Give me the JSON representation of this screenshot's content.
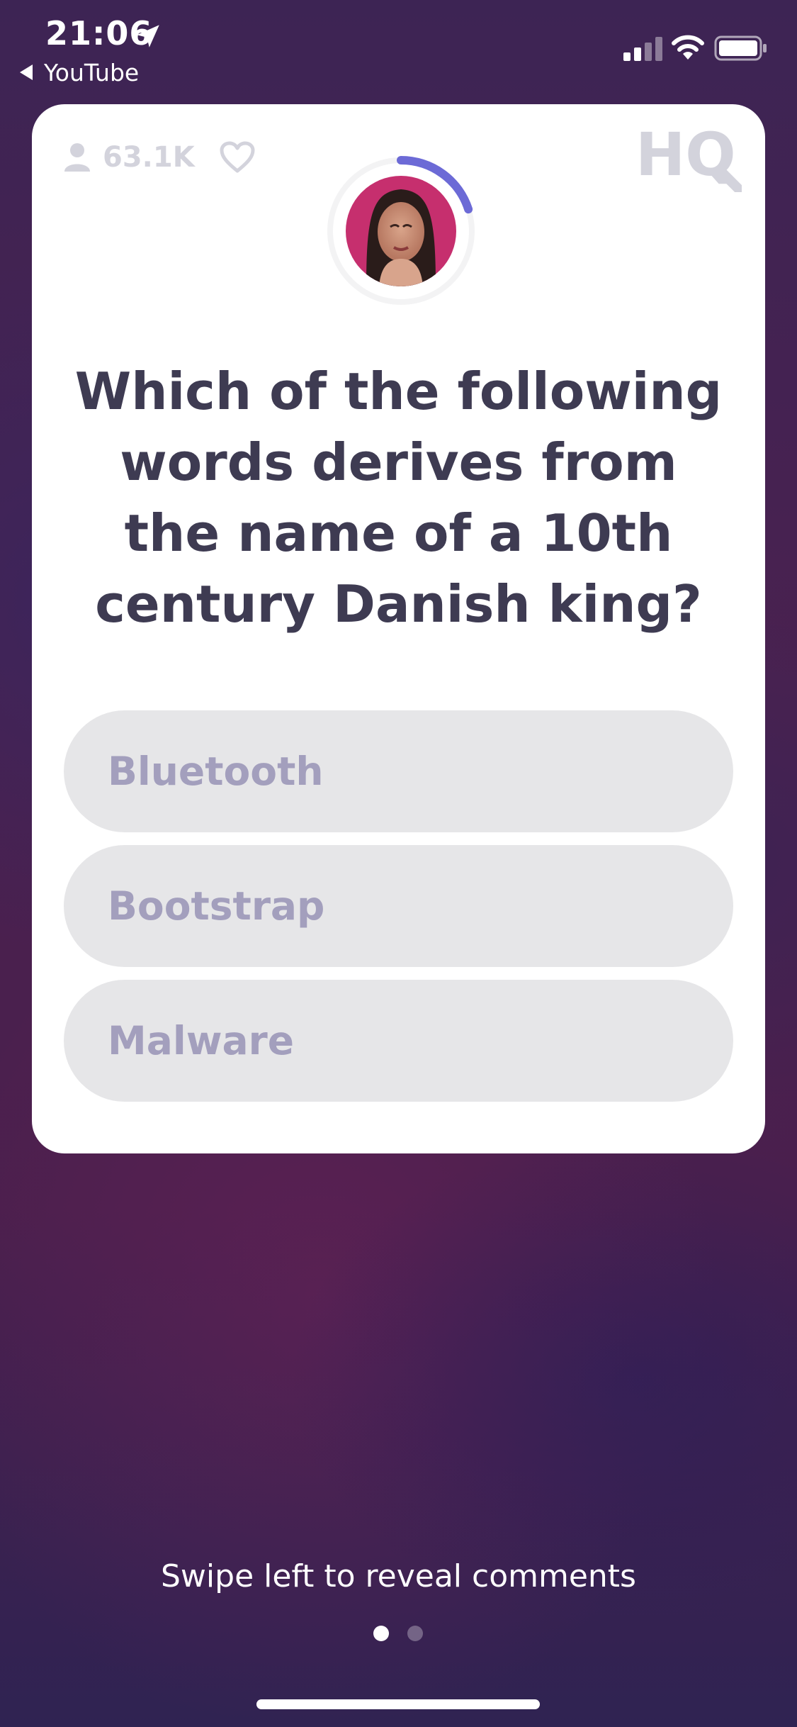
{
  "status_bar": {
    "time": "21:06",
    "back_app": "YouTube",
    "icons": [
      "location-arrow-icon",
      "cellular-signal-icon",
      "wifi-icon",
      "battery-icon"
    ]
  },
  "game": {
    "viewer_count": "63.1K",
    "logo": "HQ",
    "question": "Which of the following words derives from the name of a 10th century Danish king?",
    "answers": [
      "Bluetooth",
      "Bootstrap",
      "Malware"
    ],
    "timer_progress": 0.2
  },
  "footer": {
    "swipe_hint": "Swipe left to reveal comments",
    "pages_total": 2,
    "current_page": 1
  },
  "colors": {
    "card": "#ffffff",
    "question_text": "#3e3b52",
    "answer_bg": "#e6e6e8",
    "answer_text": "#a39fbd",
    "timer_arc": "#6c6ad6",
    "muted_icon": "#d3d3dc"
  }
}
